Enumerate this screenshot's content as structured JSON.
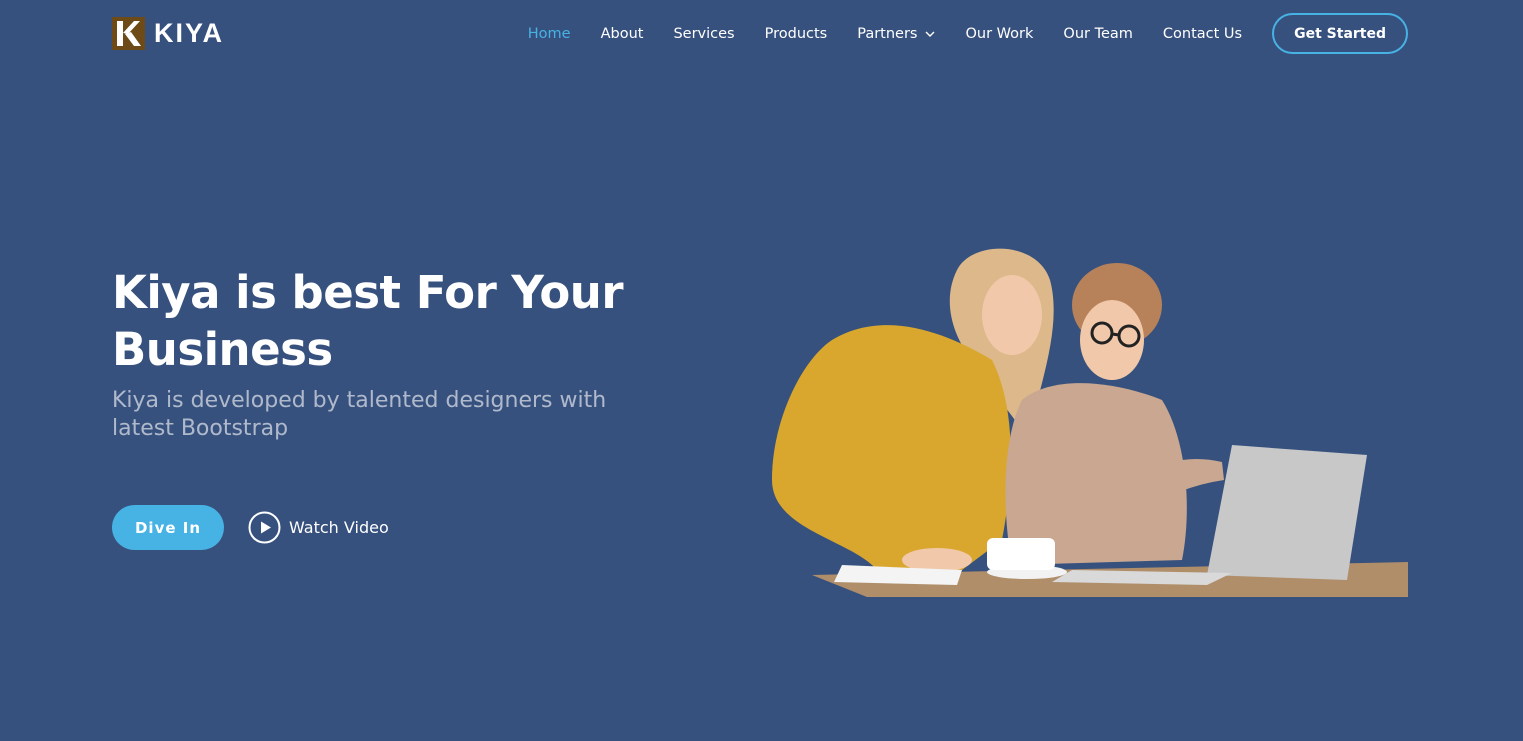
{
  "brand": {
    "logo_letter": "K",
    "name": "KIYA",
    "logo_color": "#6e4a16"
  },
  "nav": {
    "items": [
      {
        "label": "Home",
        "active": true
      },
      {
        "label": "About"
      },
      {
        "label": "Services"
      },
      {
        "label": "Products"
      },
      {
        "label": "Partners",
        "icon": "chevron-down-icon"
      },
      {
        "label": "Our Work"
      },
      {
        "label": "Our Team"
      },
      {
        "label": "Contact Us"
      }
    ],
    "cta_label": "Get Started"
  },
  "hero": {
    "title": "Kiya is best For Your Business",
    "subtitle": "Kiya is developed by talented designers with latest Bootstrap",
    "primary_button": "Dive In",
    "video_button": "Watch Video",
    "video_icon": "play-circle-icon",
    "image": "two-women-at-laptop-illustration"
  },
  "colors": {
    "background": "#37517e",
    "accent": "#47b2e4",
    "text": "#ffffff",
    "subtitle": "rgba(255,255,255,0.6)"
  }
}
